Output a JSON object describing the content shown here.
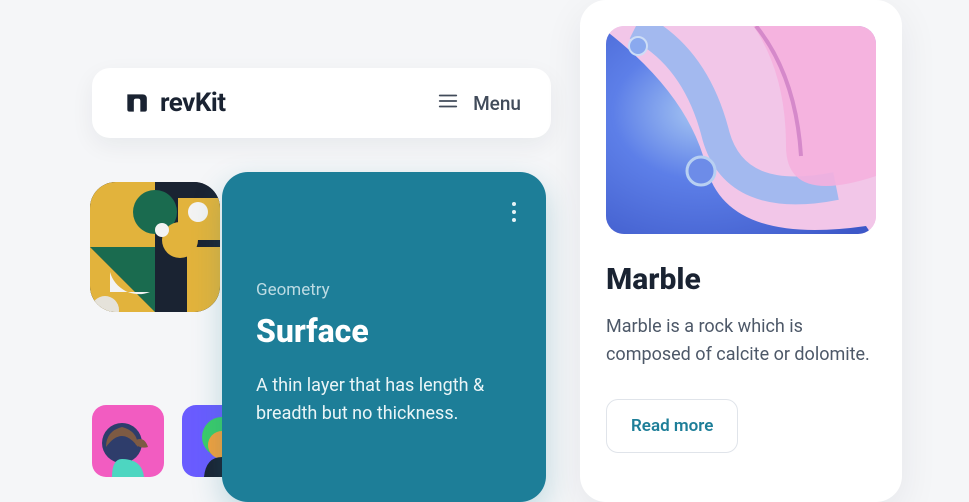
{
  "header": {
    "brand_name": "revKit",
    "menu_label": "Menu"
  },
  "card_blue": {
    "category": "Geometry",
    "title": "Surface",
    "description": "A thin layer that has length & breadth but no thickness."
  },
  "card_white": {
    "title": "Marble",
    "description": "Marble is a rock which is composed of calcite or dolomite.",
    "button_label": "Read more"
  },
  "colors": {
    "primary_blue": "#1d7e98",
    "text_dark": "#1a2332",
    "text_muted": "#4d5868"
  }
}
